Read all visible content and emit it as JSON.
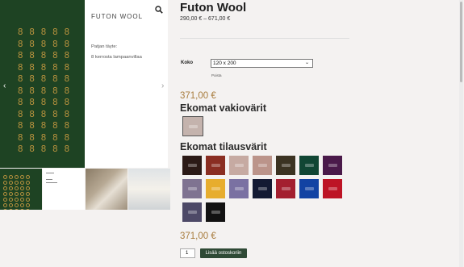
{
  "gallery": {
    "panel_title": "FUTON WOOL",
    "panel_line1": "Patjan täyte:",
    "panel_line2": "8 kerrosta lampaanvillaa",
    "prev_arrow": "‹",
    "next_arrow": "›",
    "wool_glyph": "8"
  },
  "product": {
    "title": "Futon Wool",
    "price_range": "290,00 € – 671,00 €"
  },
  "options": {
    "size_label": "Koko",
    "size_value": "120 x 200",
    "clear_label": "Poista"
  },
  "price_selected": "371,00 €",
  "standard_colors_title": "Ekomat vakiovärit",
  "custom_colors_title": "Ekomat tilausvärit",
  "price_bottom": "371,00 €",
  "cart": {
    "quantity": "1",
    "add_label": "Lisää ostoskoriin"
  },
  "colors": {
    "standard": [
      "#c4b3ad"
    ],
    "custom": [
      "#2b1a16",
      "#8a2e22",
      "#c6aaa2",
      "#bb948a",
      "#3b3322",
      "#114634",
      "#4a1a4a",
      "#7f7391",
      "#e7ad2e",
      "#7a71a2",
      "#131a33",
      "#a31f2f",
      "#1243a3",
      "#bd1425",
      "#4d4967",
      "#121212"
    ]
  }
}
